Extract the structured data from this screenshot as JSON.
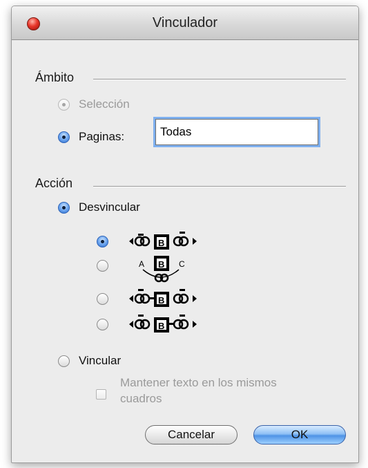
{
  "window": {
    "title": "Vinculador"
  },
  "scope": {
    "label": "Ámbito",
    "selection_label": "Selección",
    "pages_label": "Paginas:",
    "pages_value": "Todas"
  },
  "action": {
    "label": "Acción",
    "unlink_label": "Desvincular",
    "link_label": "Vincular",
    "keep_text_label_line1": "Mantener texto en los mismos",
    "keep_text_label_line2": "cuadros",
    "icon_a": "A",
    "icon_b": "B",
    "icon_c": "C"
  },
  "buttons": {
    "cancel": "Cancelar",
    "ok": "OK"
  },
  "colors": {
    "accent": "#4f93e6",
    "close": "#e8372b"
  }
}
